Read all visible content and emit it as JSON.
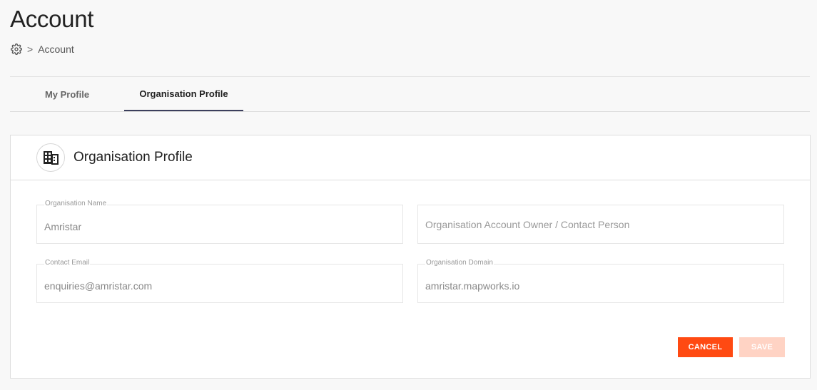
{
  "page": {
    "title": "Account"
  },
  "breadcrumb": {
    "icon": "gear-icon",
    "separator": ">",
    "current": "Account"
  },
  "tabs": [
    {
      "label": "My Profile",
      "active": false
    },
    {
      "label": "Organisation Profile",
      "active": true
    }
  ],
  "card": {
    "icon": "building-icon",
    "title": "Organisation Profile"
  },
  "form": {
    "org_name": {
      "label": "Organisation Name",
      "value": "Amristar"
    },
    "owner": {
      "placeholder": "Organisation Account Owner / Contact Person"
    },
    "contact_email": {
      "label": "Contact Email",
      "value": "enquiries@amristar.com"
    },
    "domain": {
      "label": "Organisation Domain",
      "value": "amristar.mapworks.io"
    }
  },
  "actions": {
    "cancel_label": "CANCEL",
    "save_label": "SAVE"
  },
  "colors": {
    "accent": "#ff4a12",
    "accent_disabled": "#ffd3c4",
    "tab_underline": "#3b3f5c"
  }
}
